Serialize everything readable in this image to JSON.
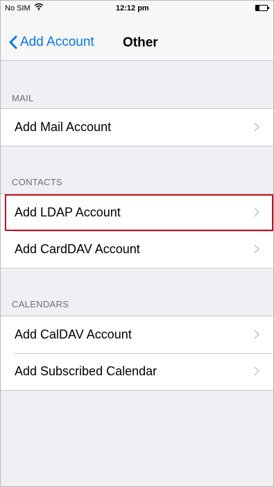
{
  "status": {
    "carrier": "No SIM",
    "time": "12:12 pm"
  },
  "nav": {
    "back_label": "Add Account",
    "title": "Other"
  },
  "sections": [
    {
      "header": "MAIL",
      "items": [
        {
          "label": "Add Mail Account"
        }
      ]
    },
    {
      "header": "CONTACTS",
      "items": [
        {
          "label": "Add LDAP Account"
        },
        {
          "label": "Add CardDAV Account"
        }
      ]
    },
    {
      "header": "CALENDARS",
      "items": [
        {
          "label": "Add CalDAV Account"
        },
        {
          "label": "Add Subscribed Calendar"
        }
      ]
    }
  ],
  "colors": {
    "accent": "#0a74e6",
    "highlight": "#c0121f",
    "background": "#efeff4"
  },
  "icons": {
    "back": "chevron-left-icon",
    "row": "chevron-right-icon",
    "wifi": "wifi-icon",
    "battery": "battery-icon"
  }
}
